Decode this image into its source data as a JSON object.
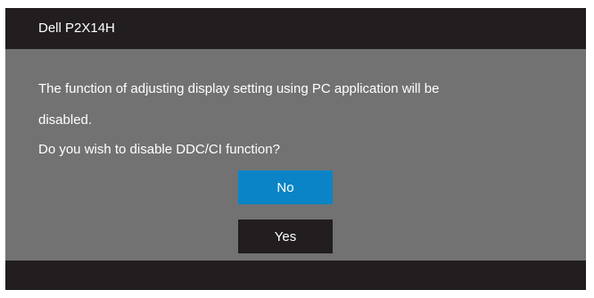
{
  "header": {
    "title": "Dell P2X14H"
  },
  "dialog": {
    "message_line1": "The function of adjusting display setting using PC application will be",
    "message_line2": "disabled.",
    "question": "Do you wish to disable DDC/CI function?"
  },
  "buttons": {
    "no_label": "No",
    "yes_label": "Yes",
    "selected": "No"
  },
  "colors": {
    "header_bg": "#221e1f",
    "body_bg": "#727272",
    "selected_button": "#0a84c6",
    "unselected_button": "#221e1f",
    "text": "#ffffff"
  }
}
